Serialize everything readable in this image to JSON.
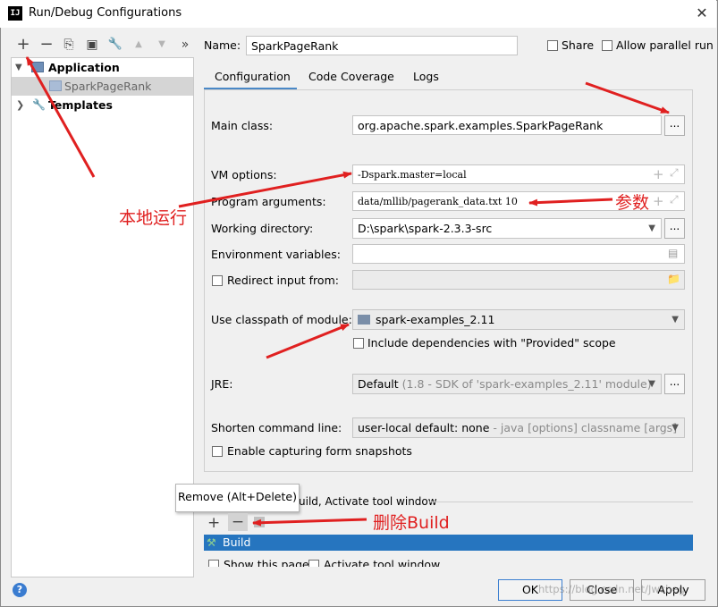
{
  "window": {
    "title": "Run/Debug Configurations",
    "close_glyph": "✕",
    "logo_text": "IJ"
  },
  "toolbar": {
    "add": "+",
    "remove": "−",
    "copy": "⎘",
    "save": "▣",
    "settings": "🔧",
    "up": "▲",
    "down": "▼",
    "more": "»"
  },
  "tree": {
    "items": [
      {
        "label": "Application",
        "expanded": true
      },
      {
        "label": "SparkPageRank",
        "selected": true
      },
      {
        "label": "Templates",
        "expanded": false
      }
    ]
  },
  "header": {
    "name_label": "Name:",
    "name_value": "SparkPageRank",
    "share_label": "Share",
    "parallel_label": "Allow parallel run"
  },
  "tabs": [
    "Configuration",
    "Code Coverage",
    "Logs"
  ],
  "form": {
    "main_class_label": "Main class:",
    "main_class_value": "org.apache.spark.examples.SparkPageRank",
    "vm_options_label": "VM options:",
    "vm_options_value": "-Dspark.master=local",
    "program_args_label": "Program arguments:",
    "program_args_value": "data/mllib/pagerank_data.txt 10",
    "working_dir_label": "Working directory:",
    "working_dir_value": "D:\\spark\\spark-2.3.3-src",
    "env_label": "Environment variables:",
    "redirect_label": "Redirect input from:",
    "classpath_label": "Use classpath of module:",
    "classpath_value": "spark-examples_2.11",
    "include_deps_label": "Include dependencies with \"Provided\" scope",
    "jre_label": "JRE:",
    "jre_value": "Default",
    "jre_hint": "(1.8 - SDK of 'spark-examples_2.11' module)",
    "shorten_label": "Shorten command line:",
    "shorten_value": "user-local default: none",
    "shorten_hint": "- java [options] classname [args]",
    "snapshots_label": "Enable capturing form snapshots",
    "ellipsis": "..."
  },
  "before_launch": {
    "title": "uild, Activate tool window",
    "tooltip": "Remove (Alt+Delete)",
    "build_item": "Build",
    "show_page_label": "Show this page",
    "activate_label": "Activate tool window"
  },
  "buttons": {
    "ok": "OK",
    "close": "Close",
    "apply": "Apply",
    "help": "?"
  },
  "annotations": {
    "local_run": "本地运行",
    "params": "参数",
    "delete_build": "删除Build"
  },
  "watermark": "https://blog.csdn.net/Jwcheg",
  "colors": {
    "accent": "#2675bf",
    "annotation": "#e02020",
    "tab_underline": "#4a88c7"
  }
}
